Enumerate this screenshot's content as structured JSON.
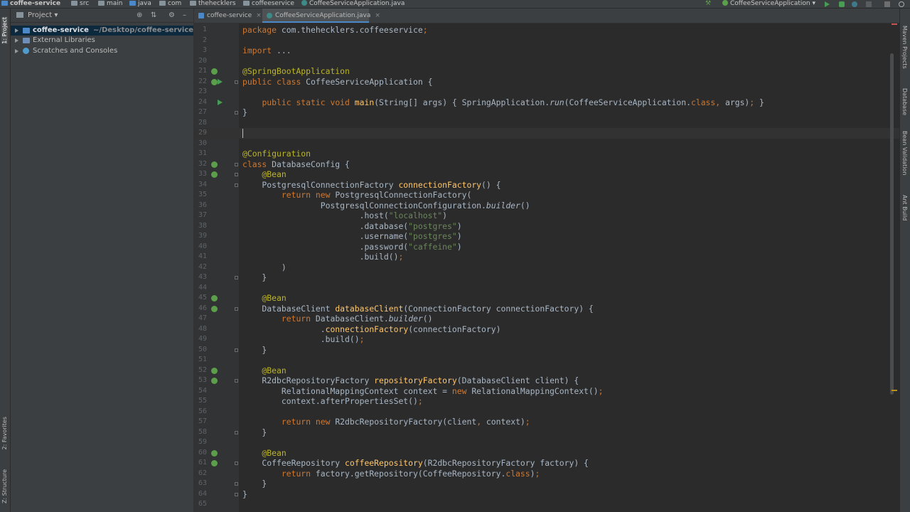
{
  "nav": {
    "crumbs": [
      "coffee-service",
      "src",
      "main",
      "java",
      "com",
      "thehecklers",
      "coffeeservice",
      "CoffeeServiceApplication.java"
    ],
    "run_config": "CoffeeServiceApplication"
  },
  "left_strip": {
    "project_label": "1: Project",
    "favorites_label": "2: Favorites",
    "structure_label": "Z: Structure"
  },
  "right_strip": {
    "labels": [
      "Maven Projects",
      "Database",
      "Bean Validation",
      "Ant Build"
    ]
  },
  "project_panel": {
    "title": "Project",
    "tree": [
      {
        "label": "coffee-service",
        "path": "~/Desktop/coffee-service"
      },
      {
        "label": "External Libraries"
      },
      {
        "label": "Scratches and Consoles"
      }
    ]
  },
  "tabs": [
    {
      "label": "coffee-service"
    },
    {
      "label": "CoffeeServiceApplication.java"
    }
  ],
  "colors": {
    "keyword": "#cc7832",
    "annotation": "#bbb529",
    "string": "#6a8759",
    "method": "#ffc66d",
    "text": "#a9b7c6",
    "selection": "#0d293e"
  },
  "editor": {
    "lines": [
      {
        "num": "1",
        "text": "package com.thehecklers.coffeeservice;"
      },
      {
        "num": "2",
        "text": ""
      },
      {
        "num": "3",
        "text": "import ..."
      },
      {
        "num": "20",
        "text": ""
      },
      {
        "num": "21",
        "text": "@SpringBootApplication"
      },
      {
        "num": "22",
        "text": "public class CoffeeServiceApplication {"
      },
      {
        "num": "23",
        "text": ""
      },
      {
        "num": "24",
        "text": "    public static void main(String[] args) { SpringApplication.run(CoffeeServiceApplication.class, args); }"
      },
      {
        "num": "27",
        "text": "}"
      },
      {
        "num": "28",
        "text": ""
      },
      {
        "num": "29",
        "text": ""
      },
      {
        "num": "30",
        "text": ""
      },
      {
        "num": "31",
        "text": "@Configuration"
      },
      {
        "num": "32",
        "text": "class DatabaseConfig {"
      },
      {
        "num": "33",
        "text": "    @Bean"
      },
      {
        "num": "34",
        "text": "    PostgresqlConnectionFactory connectionFactory() {"
      },
      {
        "num": "35",
        "text": "        return new PostgresqlConnectionFactory("
      },
      {
        "num": "36",
        "text": "                PostgresqlConnectionConfiguration.builder()"
      },
      {
        "num": "37",
        "text": "                        .host(\"localhost\")"
      },
      {
        "num": "38",
        "text": "                        .database(\"postgres\")"
      },
      {
        "num": "39",
        "text": "                        .username(\"postgres\")"
      },
      {
        "num": "40",
        "text": "                        .password(\"caffeine\")"
      },
      {
        "num": "41",
        "text": "                        .build();"
      },
      {
        "num": "42",
        "text": "        )"
      },
      {
        "num": "43",
        "text": "    }"
      },
      {
        "num": "44",
        "text": ""
      },
      {
        "num": "45",
        "text": "    @Bean"
      },
      {
        "num": "46",
        "text": "    DatabaseClient databaseClient(ConnectionFactory connectionFactory) {"
      },
      {
        "num": "47",
        "text": "        return DatabaseClient.builder()"
      },
      {
        "num": "48",
        "text": "                .connectionFactory(connectionFactory)"
      },
      {
        "num": "49",
        "text": "                .build();"
      },
      {
        "num": "50",
        "text": "    }"
      },
      {
        "num": "51",
        "text": ""
      },
      {
        "num": "52",
        "text": "    @Bean"
      },
      {
        "num": "53",
        "text": "    R2dbcRepositoryFactory repositoryFactory(DatabaseClient client) {"
      },
      {
        "num": "54",
        "text": "        RelationalMappingContext context = new RelationalMappingContext();"
      },
      {
        "num": "55",
        "text": "        context.afterPropertiesSet();"
      },
      {
        "num": "56",
        "text": ""
      },
      {
        "num": "57",
        "text": "        return new R2dbcRepositoryFactory(client, context);"
      },
      {
        "num": "58",
        "text": "    }"
      },
      {
        "num": "59",
        "text": ""
      },
      {
        "num": "60",
        "text": "    @Bean"
      },
      {
        "num": "61",
        "text": "    CoffeeRepository coffeeRepository(R2dbcRepositoryFactory factory) {"
      },
      {
        "num": "62",
        "text": "        return factory.getRepository(CoffeeRepository.class);"
      },
      {
        "num": "63",
        "text": "    }"
      },
      {
        "num": "64",
        "text": "}"
      },
      {
        "num": "65",
        "text": ""
      }
    ]
  }
}
